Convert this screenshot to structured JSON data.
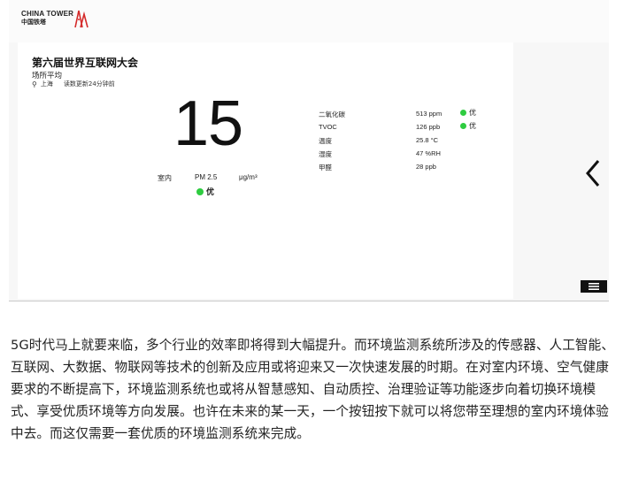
{
  "logo": {
    "en": "CHINA TOWER",
    "cn": "中国铁塔"
  },
  "site": {
    "title": "第六届世界互联网大会",
    "subtitle": "场所平均",
    "city": "上海",
    "updated": "读数更新24分钟前"
  },
  "pm25": {
    "value": "15",
    "location": "室内",
    "name": "PM 2.5",
    "unit": "μg/m³",
    "status": "优",
    "status_color": "#2ecc40"
  },
  "metrics": [
    {
      "name": "二氧化碳",
      "value": "513 ppm",
      "status": "优"
    },
    {
      "name": "TVOC",
      "value": "126 ppb",
      "status": "优"
    },
    {
      "name": "温度",
      "value": "25.8 °C",
      "status": ""
    },
    {
      "name": "湿度",
      "value": "47 %RH",
      "status": ""
    },
    {
      "name": "甲醛",
      "value": "28 ppb",
      "status": ""
    }
  ],
  "icons": {
    "next": "chevron-left-icon",
    "menu": "menu-icon",
    "location": "location-pin-icon"
  },
  "article": {
    "text": "5G时代马上就要来临，多个行业的效率即将得到大幅提升。而环境监测系统所涉及的传感器、人工智能、互联网、大数据、物联网等技术的创新及应用或将迎来又一次快速发展的时期。在对室内环境、空气健康要求的不断提高下，环境监测系统也或将从智慧感知、自动质控、治理验证等功能逐步向着切换环境模式、享受优质环境等方向发展。也许在未来的某一天，一个按钮按下就可以将您带至理想的室内环境体验中去。而这仅需要一套优质的环境监测系统来完成。"
  }
}
